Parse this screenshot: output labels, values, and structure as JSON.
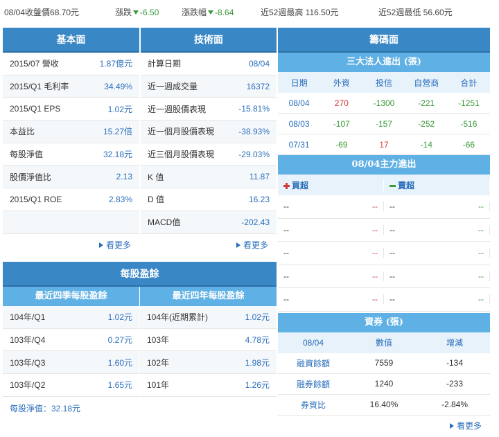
{
  "topbar": {
    "close": "08/04收盤價68.70元",
    "change_label": "漲跌",
    "change_value": "-6.50",
    "pct_label": "漲跌幅",
    "pct_value": "-8.64",
    "high52": "近52週最高 116.50元",
    "low52": "近52週最低 56.60元"
  },
  "fundamentals": {
    "title": "基本面",
    "rows": [
      {
        "k": "2015/07 營收",
        "v": "1.87億元"
      },
      {
        "k": "2015/Q1 毛利率",
        "v": "34.49%"
      },
      {
        "k": "2015/Q1 EPS",
        "v": "1.02元"
      },
      {
        "k": "本益比",
        "v": "15.27倍"
      },
      {
        "k": "每股淨值",
        "v": "32.18元"
      },
      {
        "k": "股價淨值比",
        "v": "2.13"
      },
      {
        "k": "2015/Q1 ROE",
        "v": "2.83%"
      }
    ],
    "more": "看更多"
  },
  "technicals": {
    "title": "技術面",
    "rows": [
      {
        "k": "計算日期",
        "v": "08/04",
        "c": "blue"
      },
      {
        "k": "近一週成交量",
        "v": "16372",
        "c": "blue"
      },
      {
        "k": "近一週股價表現",
        "v": "-15.81%",
        "c": "green"
      },
      {
        "k": "近一個月股價表現",
        "v": "-38.93%",
        "c": "green"
      },
      {
        "k": "近三個月股價表現",
        "v": "-29.03%",
        "c": "green"
      },
      {
        "k": "K 值",
        "v": "11.87",
        "c": "blue"
      },
      {
        "k": "D 值",
        "v": "16.23",
        "c": "blue"
      },
      {
        "k": "MACD值",
        "v": "-202.43",
        "c": "blue"
      }
    ],
    "more": "看更多"
  },
  "chips": {
    "title": "籌碼面",
    "institutional": {
      "title": "三大法人進出 (張)",
      "headers": [
        "日期",
        "外資",
        "投信",
        "自營商",
        "合計"
      ],
      "rows": [
        {
          "date": "08/04",
          "foreign": "270",
          "trust": "-1300",
          "dealer": "-221",
          "total": "-1251"
        },
        {
          "date": "08/03",
          "foreign": "-107",
          "trust": "-157",
          "dealer": "-252",
          "total": "-516"
        },
        {
          "date": "07/31",
          "foreign": "-69",
          "trust": "17",
          "dealer": "-14",
          "total": "-66"
        }
      ]
    },
    "mainforce": {
      "title": "08/04主力進出",
      "buy_label": "買超",
      "sell_label": "賣超",
      "rows": [
        {
          "bn": "--",
          "bv": "--",
          "sn": "--",
          "sv": "--"
        },
        {
          "bn": "--",
          "bv": "--",
          "sn": "--",
          "sv": "--"
        },
        {
          "bn": "--",
          "bv": "--",
          "sn": "--",
          "sv": "--"
        },
        {
          "bn": "--",
          "bv": "--",
          "sn": "--",
          "sv": "--"
        },
        {
          "bn": "--",
          "bv": "--",
          "sn": "--",
          "sv": "--"
        }
      ]
    },
    "margin": {
      "title": "資券 (張)",
      "headers": [
        "08/04",
        "數值",
        "增減"
      ],
      "rows": [
        {
          "k": "融資餘額",
          "v": "7559",
          "d": "-134"
        },
        {
          "k": "融券餘額",
          "v": "1240",
          "d": "-233"
        },
        {
          "k": "券資比",
          "v": "16.40%",
          "d": "-2.84%"
        }
      ]
    },
    "more": "看更多"
  },
  "eps": {
    "title": "每股盈餘",
    "quarter_title": "最近四季每股盈餘",
    "year_title": "最近四年每股盈餘",
    "quarters": [
      {
        "k": "104年/Q1",
        "v": "1.02元"
      },
      {
        "k": "103年/Q4",
        "v": "0.27元"
      },
      {
        "k": "103年/Q3",
        "v": "1.60元"
      },
      {
        "k": "103年/Q2",
        "v": "1.65元"
      }
    ],
    "years": [
      {
        "k": "104年(近期累計)",
        "v": "1.02元"
      },
      {
        "k": "103年",
        "v": "4.78元"
      },
      {
        "k": "102年",
        "v": "1.98元"
      },
      {
        "k": "101年",
        "v": "1.26元"
      }
    ],
    "nav": "每股淨值：32.18元"
  },
  "colors": {
    "accent": "#3a87c6",
    "subaccent": "#5fb0e4",
    "up": "#d23a3a",
    "down": "#3a9a3a",
    "link": "#2a6ebb"
  }
}
